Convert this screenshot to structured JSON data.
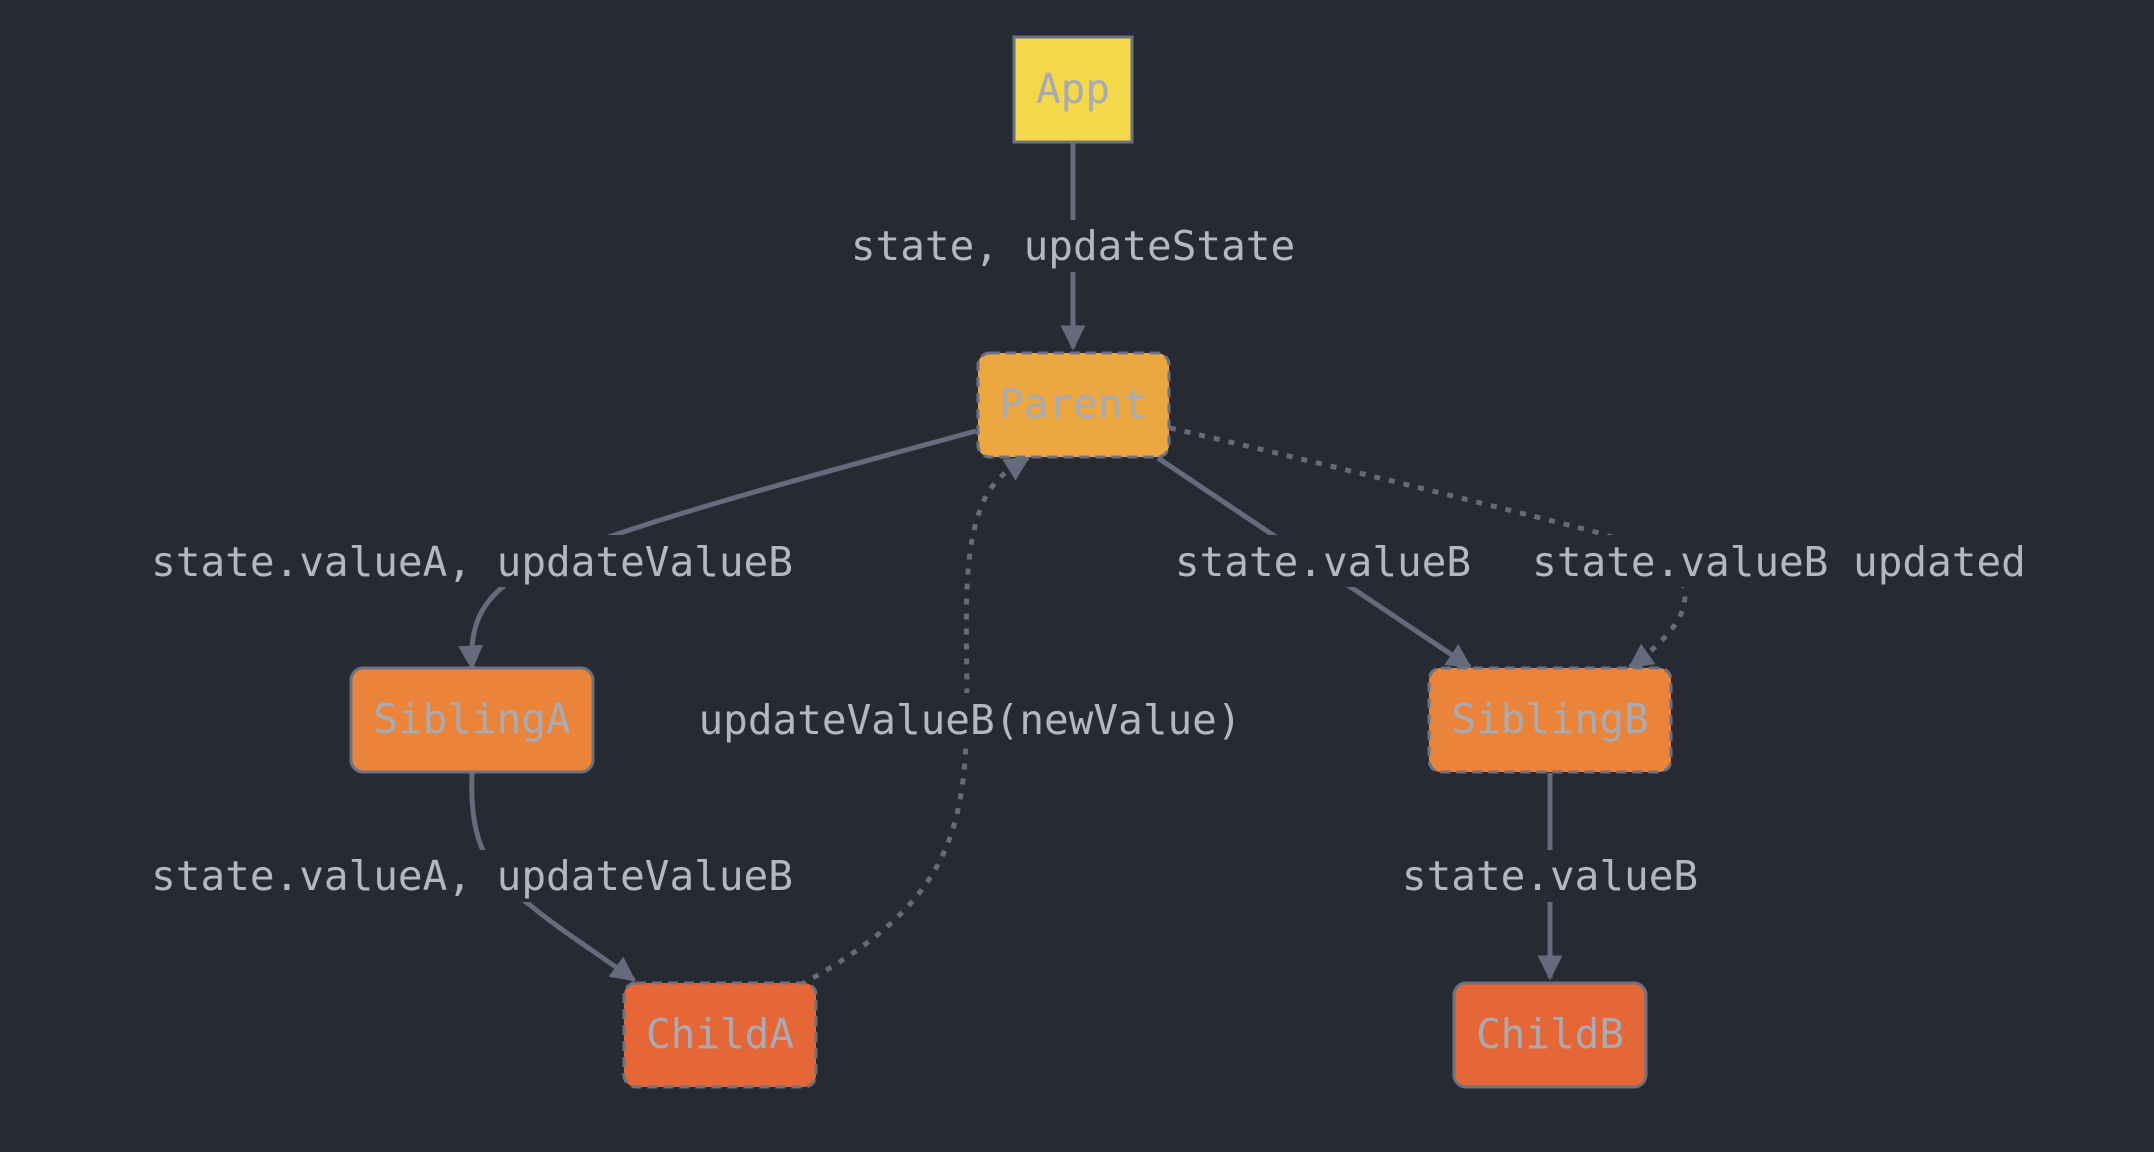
{
  "colors": {
    "background": "#282a33",
    "edge": "#646b7d",
    "node_border": "#6b7284",
    "node_text": "#a8abb3",
    "label_text": "#b4b7bf",
    "app_fill": "#f2d84a",
    "parent_fill": "#eca741",
    "sibling_fill": "#e9843a",
    "child_fill": "#e56636"
  },
  "nodes": {
    "app": {
      "label": "App"
    },
    "parent": {
      "label": "Parent"
    },
    "sibling_a": {
      "label": "SiblingA"
    },
    "sibling_b": {
      "label": "SiblingB"
    },
    "child_a": {
      "label": "ChildA"
    },
    "child_b": {
      "label": "ChildB"
    }
  },
  "edges": {
    "app_to_parent": {
      "label": "state, updateState",
      "style": "solid"
    },
    "parent_to_sibling_a": {
      "label": "state.valueA, updateValueB",
      "style": "solid"
    },
    "parent_to_sibling_b": {
      "label": "state.valueB",
      "style": "solid"
    },
    "parent_to_sibling_b_update": {
      "label": "state.valueB updated",
      "style": "dotted"
    },
    "sibling_a_to_child_a": {
      "label": "state.valueA, updateValueB",
      "style": "solid"
    },
    "child_a_to_parent": {
      "label": "updateValueB(newValue)",
      "style": "dotted"
    },
    "sibling_b_to_child_b": {
      "label": "state.valueB",
      "style": "solid"
    }
  }
}
